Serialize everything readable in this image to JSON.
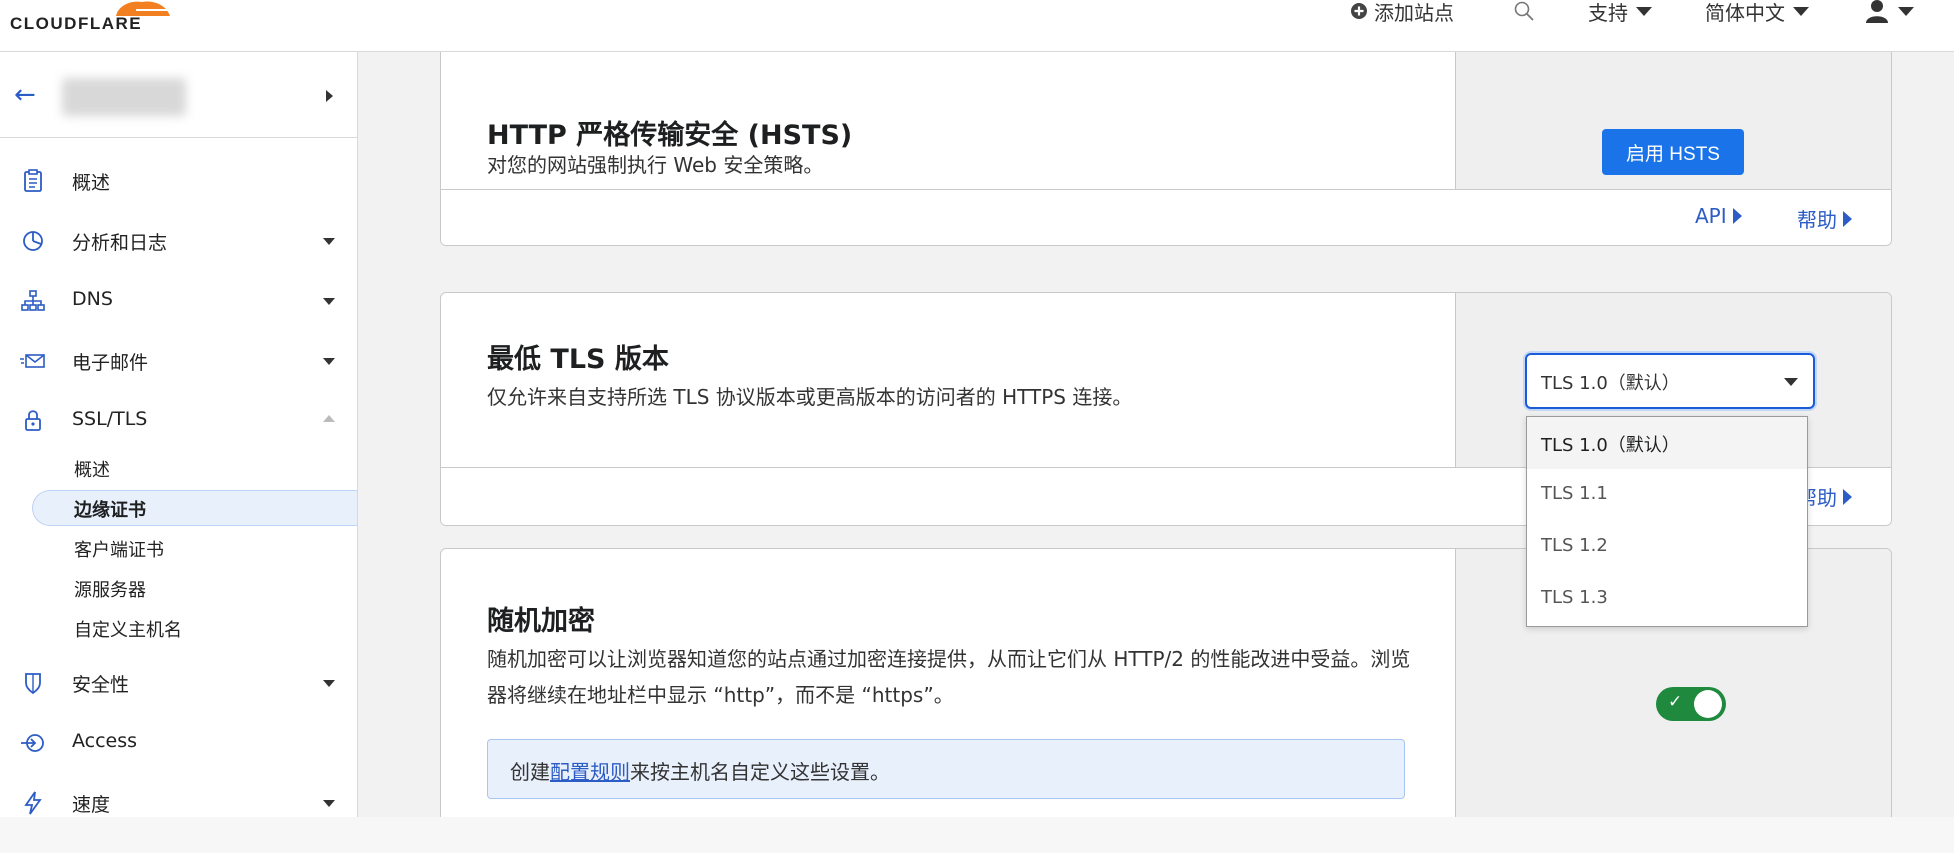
{
  "header": {
    "logo_text": "CLOUDFLARE",
    "add_site": "添加站点",
    "support": "支持",
    "language": "简体中文",
    "icons": {
      "add_site": "plus-circle-icon",
      "search": "search-icon",
      "user": "user-icon"
    }
  },
  "sidebar": {
    "site_name": "",
    "items": [
      {
        "label": "概述",
        "icon": "clipboard-icon",
        "has_caret": false
      },
      {
        "label": "分析和日志",
        "icon": "pie-chart-icon",
        "has_caret": true
      },
      {
        "label": "DNS",
        "icon": "network-icon",
        "has_caret": true
      },
      {
        "label": "电子邮件",
        "icon": "email-icon",
        "has_caret": true
      },
      {
        "label": "SSL/TLS",
        "icon": "lock-icon",
        "expanded": true
      },
      {
        "label": "安全性",
        "icon": "shield-icon",
        "has_caret": true
      },
      {
        "label": "Access",
        "icon": "access-icon",
        "has_caret": false
      },
      {
        "label": "速度",
        "icon": "bolt-icon",
        "has_caret": true
      }
    ],
    "ssl_subitems": [
      "概述",
      "边缘证书",
      "客户端证书",
      "源服务器",
      "自定义主机名"
    ],
    "active_subitem": "边缘证书"
  },
  "cards": {
    "hsts": {
      "title": "HTTP 严格传输安全 (HSTS)",
      "description": "对您的网站强制执行 Web 安全策略。",
      "button": "启用 HSTS",
      "api_link": "API",
      "help_link": "帮助"
    },
    "min_tls": {
      "title": "最低 TLS 版本",
      "description": "仅允许来自支持所选 TLS 协议版本或更高版本的访问者的 HTTPS 连接。",
      "selected": "TLS 1.0（默认）",
      "options": [
        "TLS 1.0（默认）",
        "TLS 1.1",
        "TLS 1.2",
        "TLS 1.3"
      ],
      "help_link": "帮助"
    },
    "opportunistic": {
      "title": "随机加密",
      "description": "随机加密可以让浏览器知道您的站点通过加密连接提供，从而让它们从 HTTP/2 的性能改进中受益。浏览器将继续在地址栏中显示 “http”，而不是 “https”。",
      "note_prefix": "创建",
      "note_link": "配置规则",
      "note_suffix": "来按主机名自定义这些设置。",
      "toggle_on": true
    }
  },
  "colors": {
    "accent": "#1a73e8",
    "link": "#2c5cc5",
    "toggle_on": "#1f8a3e",
    "logo_orange": "#f38020"
  }
}
